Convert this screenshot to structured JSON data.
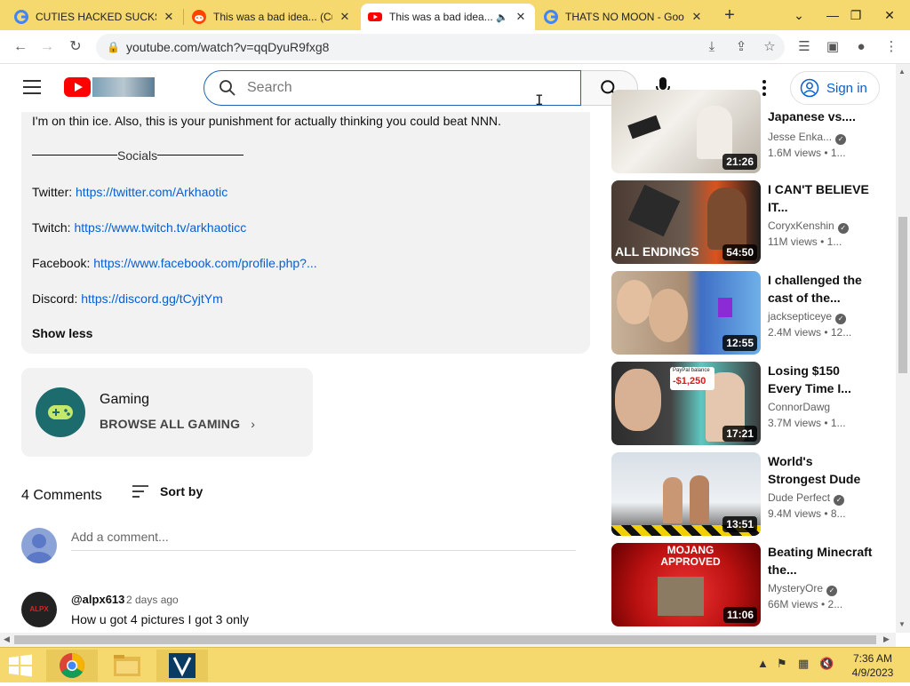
{
  "browser": {
    "tabs": [
      {
        "title": "CUTIES HACKED SUCKS - ",
        "icon": "google-icon"
      },
      {
        "title": "This was a bad idea... (Cu",
        "icon": "reddit-icon"
      },
      {
        "title": "This was a bad idea...",
        "icon": "youtube-icon",
        "active": true
      },
      {
        "title": "THATS NO MOON - Goo",
        "icon": "google-icon"
      }
    ],
    "url": "youtube.com/watch?v=qqDyuR9fxg8"
  },
  "header": {
    "search_placeholder": "Search",
    "signin_label": "Sign in"
  },
  "description": {
    "intro": "I'm on thin ice. Also, this is your punishment for actually thinking you could beat NNN.",
    "socials_label": "Socials",
    "links": [
      {
        "label": "Twitter:",
        "url": "https://twitter.com/Arkhaotic"
      },
      {
        "label": "Twitch:",
        "url": "https://www.twitch.tv/arkhaoticc"
      },
      {
        "label": "Facebook:",
        "url": "https://www.facebook.com/profile.php?..."
      },
      {
        "label": "Discord:",
        "url": "https://discord.gg/tCyjtYm"
      }
    ],
    "show_less": "Show less"
  },
  "gaming": {
    "title": "Gaming",
    "browse_label": "BROWSE ALL GAMING"
  },
  "comments": {
    "count_label": "4 Comments",
    "sort_label": "Sort by",
    "add_placeholder": "Add a comment...",
    "items": [
      {
        "author": "@alpx613",
        "time": "2 days ago",
        "text": "How u got 4 pictures I got 3 only",
        "avatar_text": "ALPX"
      }
    ]
  },
  "recommendations": [
    {
      "title": "Japanese vs....",
      "channel": "Jesse Enka...",
      "meta": "1.6M views  •  1...",
      "duration": "21:26"
    },
    {
      "title": "I CAN'T BELIEVE IT...",
      "channel": "CoryxKenshin",
      "meta": "11M views  •  1...",
      "duration": "54:50",
      "thumb_text": "ALL ENDINGS"
    },
    {
      "title": "I challenged the cast of the...",
      "channel": "jacksepticeye",
      "meta": "2.4M views  •  12...",
      "duration": "12:55"
    },
    {
      "title": "Losing $150 Every Time I...",
      "channel": "ConnorDawg",
      "meta": "3.7M views  •  1...",
      "duration": "17:21",
      "thumb_text": "-$1,250",
      "thumb_caption": "PayPal balance"
    },
    {
      "title": "World's Strongest Dude",
      "channel": "Dude Perfect",
      "meta": "9.4M views  •  8...",
      "duration": "13:51"
    },
    {
      "title": "Beating Minecraft the...",
      "channel": "MysteryOre",
      "meta": "66M views  •  2...",
      "duration": "11:06",
      "thumb_text": "MOJANG APPROVED"
    }
  ],
  "taskbar": {
    "time": "7:36 AM",
    "date": "4/9/2023"
  },
  "colors": {
    "chrome_frame": "#f5d96f",
    "link_blue": "#065fd4",
    "youtube_red": "#ff0000"
  }
}
